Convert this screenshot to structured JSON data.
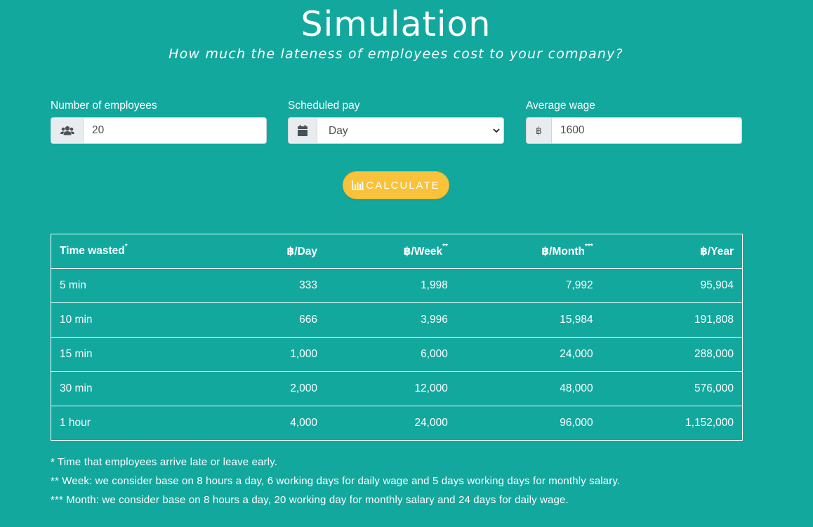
{
  "header": {
    "title": "Simulation",
    "subtitle": "How much the lateness of employees cost to your company?"
  },
  "form": {
    "employees": {
      "label": "Number of employees",
      "icon": "users-icon",
      "value": "20"
    },
    "scheduled_pay": {
      "label": "Scheduled pay",
      "icon": "calendar-icon",
      "selected": "Day"
    },
    "wage": {
      "label": "Average wage",
      "currency_symbol": "฿",
      "value": "1600"
    },
    "calculate_button": {
      "label": "CALCULATE",
      "icon": "chart-bar-icon"
    }
  },
  "table": {
    "headers": {
      "time": "Time wasted",
      "time_mark": "*",
      "day": "฿/Day",
      "week": "฿/Week",
      "week_mark": "**",
      "month": "฿/Month",
      "month_mark": "***",
      "year": "฿/Year"
    },
    "rows": [
      {
        "time": "5 min",
        "day": "333",
        "week": "1,998",
        "month": "7,992",
        "year": "95,904"
      },
      {
        "time": "10 min",
        "day": "666",
        "week": "3,996",
        "month": "15,984",
        "year": "191,808"
      },
      {
        "time": "15 min",
        "day": "1,000",
        "week": "6,000",
        "month": "24,000",
        "year": "288,000"
      },
      {
        "time": "30 min",
        "day": "2,000",
        "week": "12,000",
        "month": "48,000",
        "year": "576,000"
      },
      {
        "time": "1 hour",
        "day": "4,000",
        "week": "24,000",
        "month": "96,000",
        "year": "1,152,000"
      }
    ]
  },
  "notes": [
    "* Time that employees arrive late or leave early.",
    "** Week: we consider base on 8 hours a day, 6 working days for daily wage and 5 days working days for monthly salary.",
    "*** Month: we consider base on 8 hours a day, 20 working day for monthly salary and 24 days for daily wage."
  ],
  "colors": {
    "background": "#13a89e",
    "button": "#f8c23a",
    "text": "#ffffff"
  }
}
